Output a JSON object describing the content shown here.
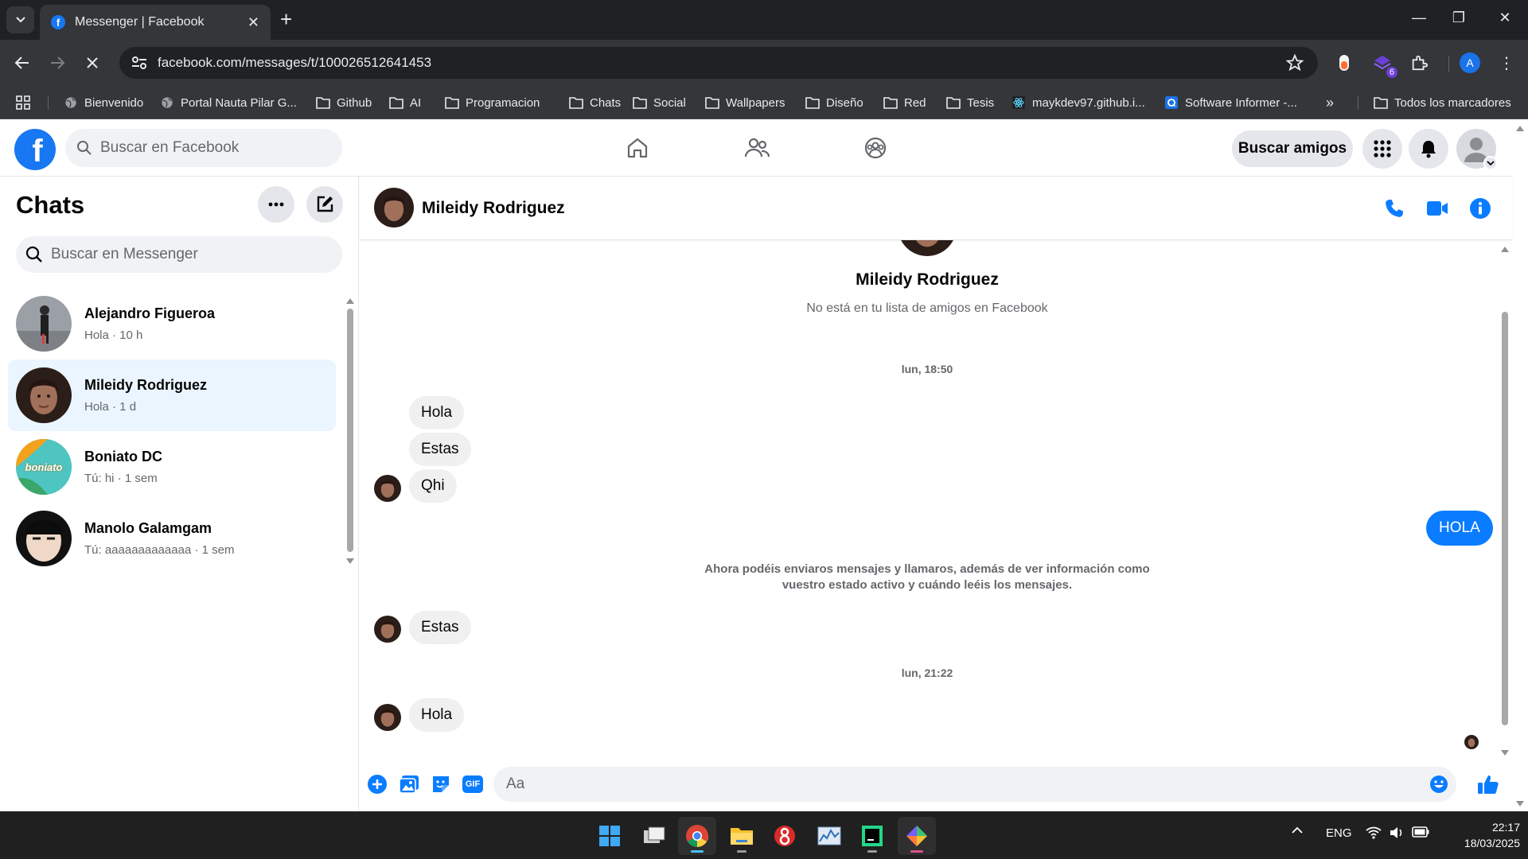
{
  "browser": {
    "tab_title": "Messenger | Facebook",
    "url": "facebook.com/messages/t/100026512641453",
    "profile_initial": "A",
    "extension_badge": "6",
    "bookmarks": [
      {
        "label": "Bienvenido",
        "icon": "globe-icon"
      },
      {
        "label": "Portal Nauta Pilar G...",
        "icon": "globe-icon"
      },
      {
        "label": "Github",
        "icon": "folder-icon"
      },
      {
        "label": "AI",
        "icon": "folder-icon"
      },
      {
        "label": "Programacion",
        "icon": "folder-icon"
      },
      {
        "label": "Chats",
        "icon": "folder-icon"
      },
      {
        "label": "Social",
        "icon": "folder-icon"
      },
      {
        "label": "Wallpapers",
        "icon": "folder-icon"
      },
      {
        "label": "Diseño",
        "icon": "folder-icon"
      },
      {
        "label": "Red",
        "icon": "folder-icon"
      },
      {
        "label": "Tesis",
        "icon": "folder-icon"
      },
      {
        "label": "maykdev97.github.i...",
        "icon": "react-icon"
      },
      {
        "label": "Software Informer -...",
        "icon": "informer-icon"
      }
    ],
    "all_bookmarks": "Todos los marcadores"
  },
  "facebook": {
    "search_placeholder": "Buscar en Facebook",
    "find_friends": "Buscar amigos"
  },
  "sidebar": {
    "title": "Chats",
    "search_placeholder": "Buscar en Messenger",
    "chats": [
      {
        "name": "Alejandro Figueroa",
        "preview": "Hola · 10 h",
        "active": false
      },
      {
        "name": "Mileidy Rodriguez",
        "preview": "Hola · 1 d",
        "active": true
      },
      {
        "name": "Boniato DC",
        "preview": "Tú: hi · 1 sem",
        "active": false,
        "avatar_text": "boniato"
      },
      {
        "name": "Manolo Galamgam",
        "preview": "Tú: aaaaaaaaaaaaa · 1 sem",
        "active": false
      }
    ]
  },
  "conversation": {
    "contact_name": "Mileidy Rodriguez",
    "profile_subtitle": "No está en tu lista de amigos en Facebook",
    "timestamp1": "lun, 18:50",
    "timestamp2": "lun, 21:22",
    "messages": {
      "m1": "Hola",
      "m2": "Estas",
      "m3": "Qhi",
      "out1": "HOLA",
      "m4": "Estas",
      "m5": "Hola"
    },
    "notice": "Ahora podéis enviaros mensajes y llamaros, además de ver información como vuestro estado activo y cuándo leéis los mensajes.",
    "composer_placeholder": "Aa",
    "gif_label": "GIF"
  },
  "taskbar": {
    "language": "ENG",
    "time": "22:17",
    "date": "18/03/2025"
  },
  "colors": {
    "brand": "#1877f2",
    "outgoing_bubble": "#0a7cff",
    "active_chat_bg": "#ebf5ff"
  }
}
